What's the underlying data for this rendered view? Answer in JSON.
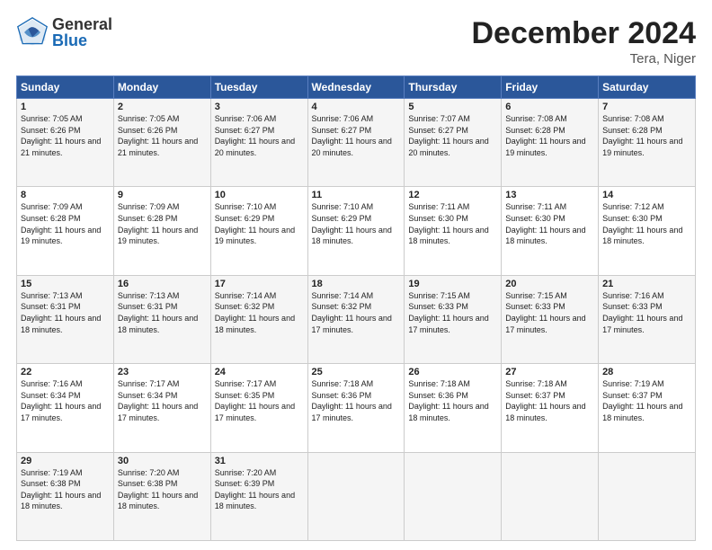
{
  "header": {
    "logo_general": "General",
    "logo_blue": "Blue",
    "month_title": "December 2024",
    "location": "Tera, Niger"
  },
  "days_of_week": [
    "Sunday",
    "Monday",
    "Tuesday",
    "Wednesday",
    "Thursday",
    "Friday",
    "Saturday"
  ],
  "weeks": [
    [
      {
        "day": 1,
        "sunrise": "7:05 AM",
        "sunset": "6:26 PM",
        "daylight": "11 hours and 21 minutes."
      },
      {
        "day": 2,
        "sunrise": "7:05 AM",
        "sunset": "6:26 PM",
        "daylight": "11 hours and 21 minutes."
      },
      {
        "day": 3,
        "sunrise": "7:06 AM",
        "sunset": "6:27 PM",
        "daylight": "11 hours and 20 minutes."
      },
      {
        "day": 4,
        "sunrise": "7:06 AM",
        "sunset": "6:27 PM",
        "daylight": "11 hours and 20 minutes."
      },
      {
        "day": 5,
        "sunrise": "7:07 AM",
        "sunset": "6:27 PM",
        "daylight": "11 hours and 20 minutes."
      },
      {
        "day": 6,
        "sunrise": "7:08 AM",
        "sunset": "6:28 PM",
        "daylight": "11 hours and 19 minutes."
      },
      {
        "day": 7,
        "sunrise": "7:08 AM",
        "sunset": "6:28 PM",
        "daylight": "11 hours and 19 minutes."
      }
    ],
    [
      {
        "day": 8,
        "sunrise": "7:09 AM",
        "sunset": "6:28 PM",
        "daylight": "11 hours and 19 minutes."
      },
      {
        "day": 9,
        "sunrise": "7:09 AM",
        "sunset": "6:28 PM",
        "daylight": "11 hours and 19 minutes."
      },
      {
        "day": 10,
        "sunrise": "7:10 AM",
        "sunset": "6:29 PM",
        "daylight": "11 hours and 19 minutes."
      },
      {
        "day": 11,
        "sunrise": "7:10 AM",
        "sunset": "6:29 PM",
        "daylight": "11 hours and 18 minutes."
      },
      {
        "day": 12,
        "sunrise": "7:11 AM",
        "sunset": "6:30 PM",
        "daylight": "11 hours and 18 minutes."
      },
      {
        "day": 13,
        "sunrise": "7:11 AM",
        "sunset": "6:30 PM",
        "daylight": "11 hours and 18 minutes."
      },
      {
        "day": 14,
        "sunrise": "7:12 AM",
        "sunset": "6:30 PM",
        "daylight": "11 hours and 18 minutes."
      }
    ],
    [
      {
        "day": 15,
        "sunrise": "7:13 AM",
        "sunset": "6:31 PM",
        "daylight": "11 hours and 18 minutes."
      },
      {
        "day": 16,
        "sunrise": "7:13 AM",
        "sunset": "6:31 PM",
        "daylight": "11 hours and 18 minutes."
      },
      {
        "day": 17,
        "sunrise": "7:14 AM",
        "sunset": "6:32 PM",
        "daylight": "11 hours and 18 minutes."
      },
      {
        "day": 18,
        "sunrise": "7:14 AM",
        "sunset": "6:32 PM",
        "daylight": "11 hours and 17 minutes."
      },
      {
        "day": 19,
        "sunrise": "7:15 AM",
        "sunset": "6:33 PM",
        "daylight": "11 hours and 17 minutes."
      },
      {
        "day": 20,
        "sunrise": "7:15 AM",
        "sunset": "6:33 PM",
        "daylight": "11 hours and 17 minutes."
      },
      {
        "day": 21,
        "sunrise": "7:16 AM",
        "sunset": "6:33 PM",
        "daylight": "11 hours and 17 minutes."
      }
    ],
    [
      {
        "day": 22,
        "sunrise": "7:16 AM",
        "sunset": "6:34 PM",
        "daylight": "11 hours and 17 minutes."
      },
      {
        "day": 23,
        "sunrise": "7:17 AM",
        "sunset": "6:34 PM",
        "daylight": "11 hours and 17 minutes."
      },
      {
        "day": 24,
        "sunrise": "7:17 AM",
        "sunset": "6:35 PM",
        "daylight": "11 hours and 17 minutes."
      },
      {
        "day": 25,
        "sunrise": "7:18 AM",
        "sunset": "6:36 PM",
        "daylight": "11 hours and 17 minutes."
      },
      {
        "day": 26,
        "sunrise": "7:18 AM",
        "sunset": "6:36 PM",
        "daylight": "11 hours and 18 minutes."
      },
      {
        "day": 27,
        "sunrise": "7:18 AM",
        "sunset": "6:37 PM",
        "daylight": "11 hours and 18 minutes."
      },
      {
        "day": 28,
        "sunrise": "7:19 AM",
        "sunset": "6:37 PM",
        "daylight": "11 hours and 18 minutes."
      }
    ],
    [
      {
        "day": 29,
        "sunrise": "7:19 AM",
        "sunset": "6:38 PM",
        "daylight": "11 hours and 18 minutes."
      },
      {
        "day": 30,
        "sunrise": "7:20 AM",
        "sunset": "6:38 PM",
        "daylight": "11 hours and 18 minutes."
      },
      {
        "day": 31,
        "sunrise": "7:20 AM",
        "sunset": "6:39 PM",
        "daylight": "11 hours and 18 minutes."
      },
      null,
      null,
      null,
      null
    ]
  ]
}
